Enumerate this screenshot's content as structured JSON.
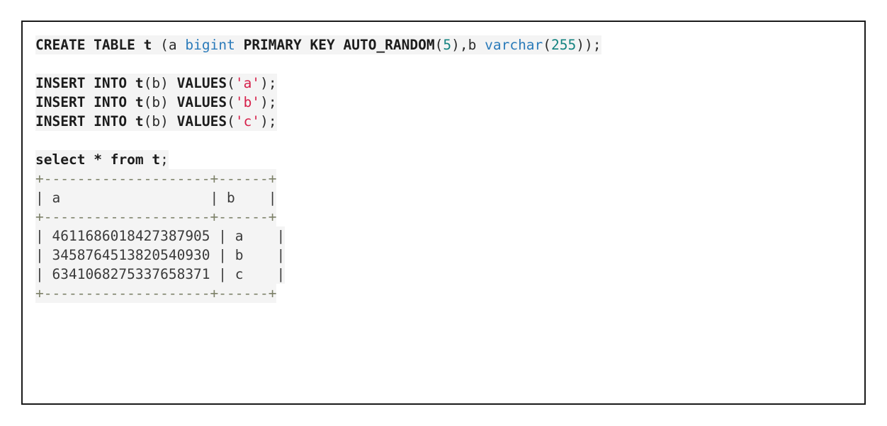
{
  "block": {
    "language": "sql",
    "border_color": "#1a1a1a",
    "code_background": "#f4f4f4",
    "page_background": "#ffffff"
  },
  "colors": {
    "keyword": "#1c1c1c",
    "type": "#2b7bba",
    "number": "#12827f",
    "string": "#d6204a",
    "plain": "#2b2b2b",
    "table_separator": "#7c8068",
    "table_pipe": "#4d4d4d",
    "table_text": "#3a3a3a"
  },
  "sql": {
    "create_table": {
      "kw_create": "CREATE TABLE",
      "table_name": "t",
      "open_paren": " (",
      "col_a_name": "a",
      "col_a_type": "bigint",
      "kw_primary_key": "PRIMARY KEY",
      "kw_auto_random": "AUTO_RANDOM",
      "auto_random_open": "(",
      "auto_random_arg": "5",
      "auto_random_close": ")",
      "comma": ",",
      "col_b_name": "b",
      "col_b_type": "varchar",
      "col_b_open": "(",
      "col_b_len": "255",
      "col_b_close": ")",
      "close_paren": ")",
      "semicolon": ";"
    },
    "inserts": [
      {
        "kw_insert": "INSERT INTO",
        "table": "t",
        "cols": "(b)",
        "kw_values": "VALUES",
        "open": "(",
        "value": "'a'",
        "close": ")",
        "semicolon": ";"
      },
      {
        "kw_insert": "INSERT INTO",
        "table": "t",
        "cols": "(b)",
        "kw_values": "VALUES",
        "open": "(",
        "value": "'b'",
        "close": ")",
        "semicolon": ";"
      },
      {
        "kw_insert": "INSERT INTO",
        "table": "t",
        "cols": "(b)",
        "kw_values": "VALUES",
        "open": "(",
        "value": "'c'",
        "close": ")",
        "semicolon": ";"
      }
    ],
    "select": {
      "kw_select": "select",
      "star": "*",
      "kw_from": "from",
      "table": "t",
      "semicolon": ";"
    }
  },
  "result_table": {
    "top_border": "+--------------------+------+",
    "header_row": "| a                  | b    |",
    "header_sep": "+--------------------+------+",
    "rows": [
      "| 4611686018427387905 | a    |",
      "| 3458764513820540930 | b    |",
      "| 6341068275337658371 | c    |"
    ],
    "bottom_border": "+--------------------+------+",
    "columns": [
      "a",
      "b"
    ],
    "data": [
      {
        "a": "4611686018427387905",
        "b": "a"
      },
      {
        "a": "3458764513820540930",
        "b": "b"
      },
      {
        "a": "6341068275337658371",
        "b": "c"
      }
    ]
  },
  "ascii": {
    "sep_left": "+",
    "sep_dashes_a": "--------------------",
    "sep_mid": "+",
    "sep_dashes_b": "------",
    "sep_right": "+",
    "pipe": "|"
  }
}
